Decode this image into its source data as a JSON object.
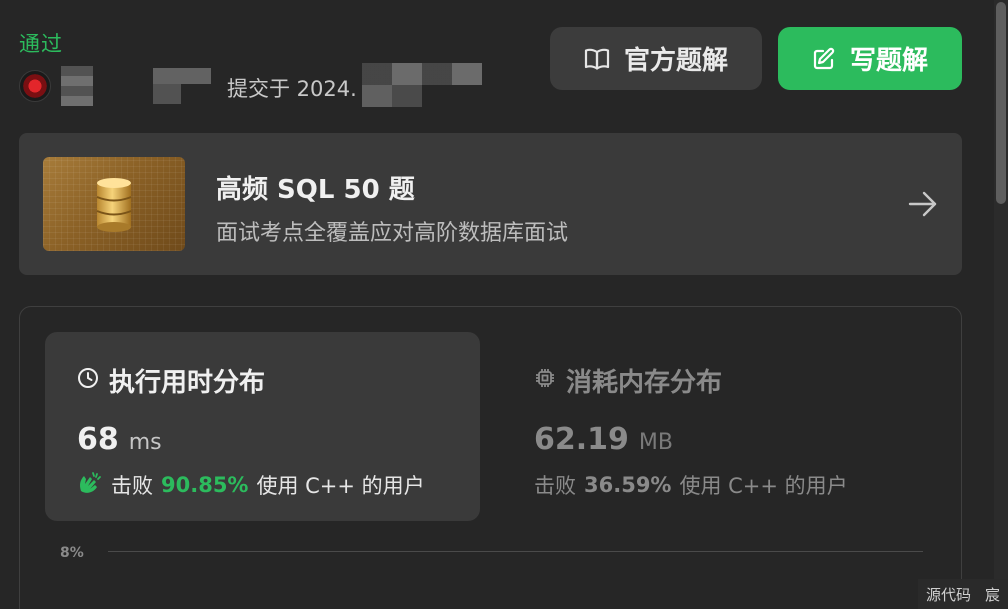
{
  "submission": {
    "status": "通过",
    "submitted_text": "提交于 2024."
  },
  "header_buttons": {
    "official_solution": "官方题解",
    "write_solution": "写题解"
  },
  "banner": {
    "title": "高频 SQL 50 题",
    "subtitle": "面试考点全覆盖应对高阶数据库面试"
  },
  "runtime": {
    "title": "执行用时分布",
    "value": "68",
    "unit": "ms",
    "beat_prefix": "击败",
    "beat_pct": "90.85%",
    "beat_suffix": "使用 C++ 的用户"
  },
  "memory": {
    "title": "消耗内存分布",
    "value": "62.19",
    "unit": "MB",
    "beat_prefix": "击败",
    "beat_pct": "36.59%",
    "beat_suffix": "使用 C++ 的用户"
  },
  "chart": {
    "y_tick": "8%"
  },
  "bottom_bar": {
    "source_code": "源代码",
    "next": "宸"
  },
  "colors": {
    "accent_green": "#2cbb5d",
    "background": "#262626",
    "card": "#3a3a3a"
  }
}
